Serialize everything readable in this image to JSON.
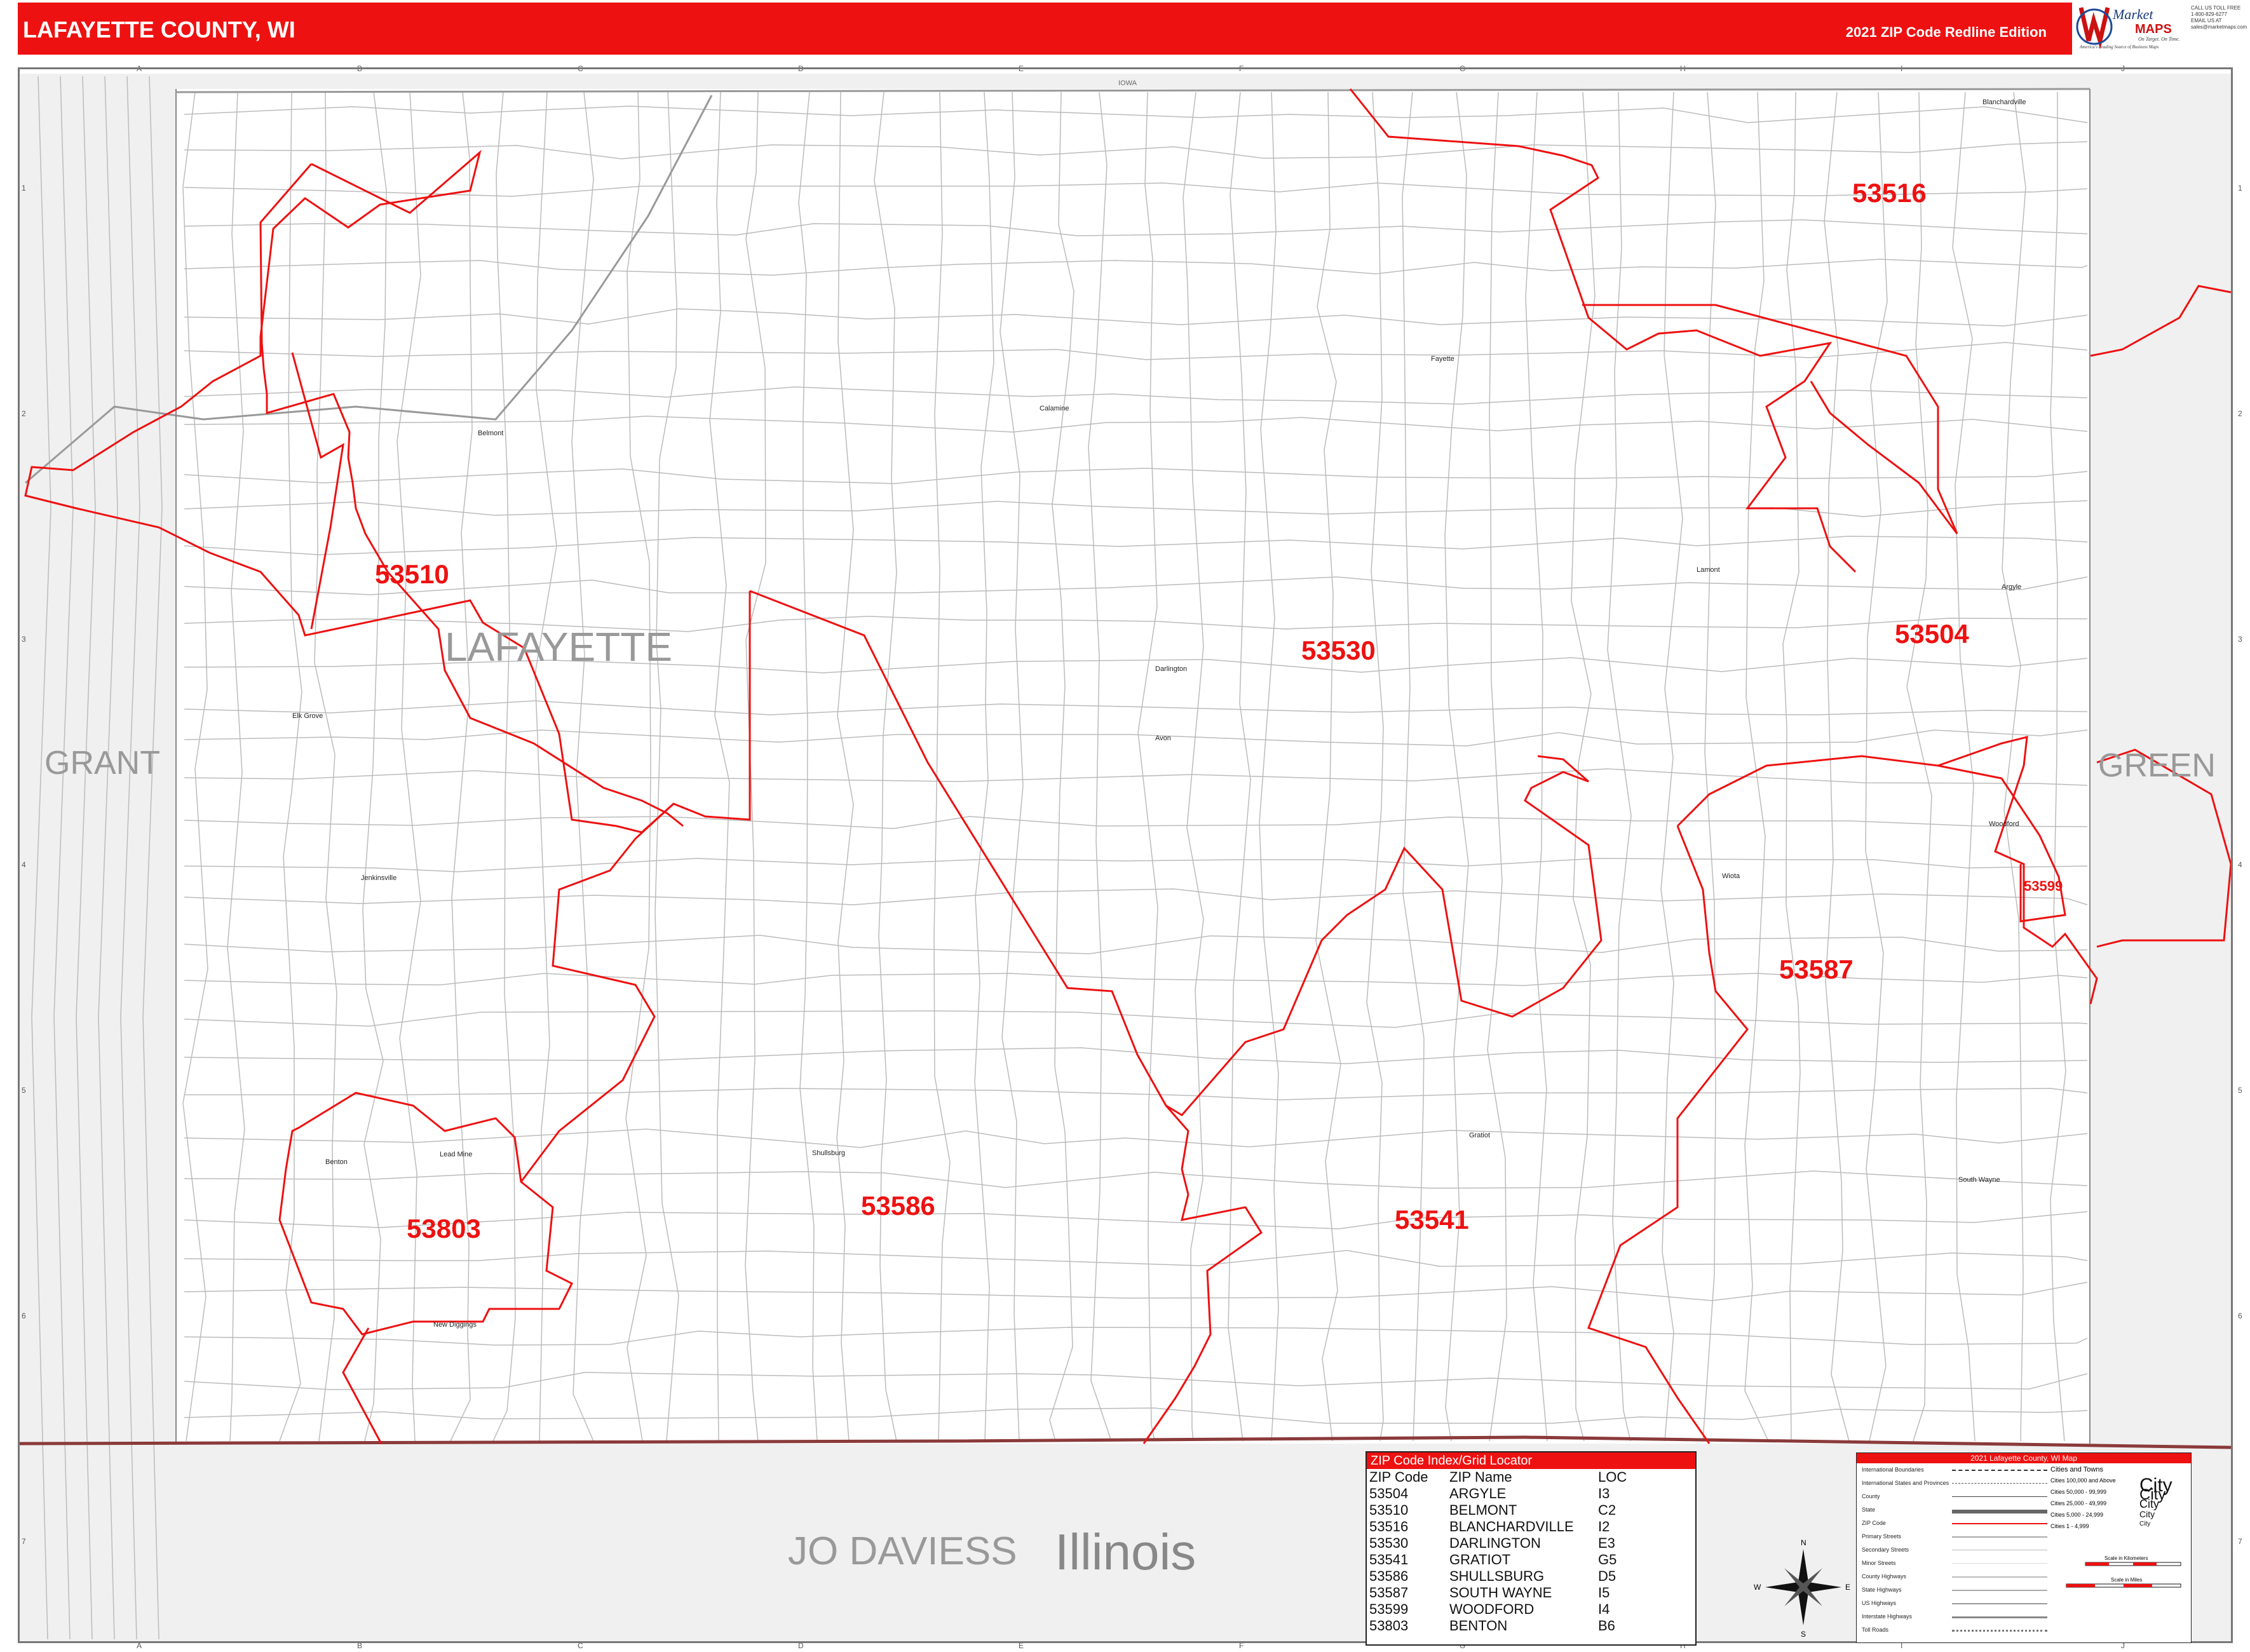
{
  "header": {
    "title": "LAFAYETTE COUNTY, WI",
    "edition": "2021 ZIP Code Redline Edition"
  },
  "brand": {
    "name_top": "Market",
    "name_bottom": "MAPS",
    "tagline1": "On Target. On Time.",
    "tagline2": "America's Leading Source of Business Maps",
    "contact": [
      "CALL US TOLL FREE",
      "1-800-829-6277",
      "EMAIL US AT",
      "sales@marketmaps.com"
    ]
  },
  "grid": {
    "columns": [
      "A",
      "B",
      "C",
      "D",
      "E",
      "F",
      "G",
      "H",
      "I",
      "J"
    ],
    "rows": [
      "1",
      "2",
      "3",
      "4",
      "5",
      "6",
      "7"
    ]
  },
  "map": {
    "state_label_top": "IOWA",
    "county_label": "LAFAYETTE",
    "neighbors": {
      "west": "GRANT",
      "east": "GREEN",
      "south_county": "JO DAVIESS",
      "south_state": "Illinois"
    },
    "zip_labels": [
      "53516",
      "53510",
      "53530",
      "53504",
      "53587",
      "53599",
      "53803",
      "53586",
      "53541"
    ],
    "towns": [
      "Blanchardville",
      "Belmont",
      "Fayette",
      "Argyle",
      "Darlington",
      "Elk Grove",
      "Avon",
      "Woodford",
      "Jenkinsville",
      "Shullsburg",
      "Benton",
      "Lead Mine",
      "New Diggings",
      "Gratiot",
      "South Wayne",
      "Lamont",
      "Wiota",
      "Calamine"
    ],
    "colors": {
      "zip_boundary": "#ee1111",
      "roads": "#bbbbbb",
      "outside_area": "#f0f0f0",
      "state_line": "#8b3a3a"
    }
  },
  "zip_index": {
    "title": "ZIP Code Index/Grid Locator",
    "headers": {
      "zip": "ZIP Code",
      "name": "ZIP Name",
      "loc": "LOC"
    },
    "rows": [
      {
        "zip": "53504",
        "name": "ARGYLE",
        "loc": "I3"
      },
      {
        "zip": "53510",
        "name": "BELMONT",
        "loc": "C2"
      },
      {
        "zip": "53516",
        "name": "BLANCHARDVILLE",
        "loc": "I2"
      },
      {
        "zip": "53530",
        "name": "DARLINGTON",
        "loc": "E3"
      },
      {
        "zip": "53541",
        "name": "GRATIOT",
        "loc": "G5"
      },
      {
        "zip": "53586",
        "name": "SHULLSBURG",
        "loc": "D5"
      },
      {
        "zip": "53587",
        "name": "SOUTH WAYNE",
        "loc": "I5"
      },
      {
        "zip": "53599",
        "name": "WOODFORD",
        "loc": "I4"
      },
      {
        "zip": "53803",
        "name": "BENTON",
        "loc": "B6"
      }
    ]
  },
  "compass": {
    "n": "N",
    "s": "S",
    "e": "E",
    "w": "W"
  },
  "legend": {
    "title": "2021 Lafayette County, WI Map",
    "items": [
      "International Boundaries",
      "International States and Provinces",
      "County",
      "State",
      "ZIP Code",
      "Primary Streets",
      "Secondary Streets",
      "Minor Streets",
      "County Highways",
      "State Highways",
      "US Highways",
      "Interstate Highways",
      "Toll Roads"
    ],
    "cities_header": "Cities and Towns",
    "cities": [
      {
        "label": "Cities 100,000 and Above",
        "sample": "City"
      },
      {
        "label": "Cities 50,000 - 99,999",
        "sample": "City"
      },
      {
        "label": "Cities 25,000 - 49,999",
        "sample": "City"
      },
      {
        "label": "Cities 5,000 - 24,999",
        "sample": "City"
      },
      {
        "label": "Cities 1 - 4,999",
        "sample": "City"
      }
    ],
    "scale_km": "Scale in Kilometers",
    "scale_mi": "Scale in Miles"
  }
}
